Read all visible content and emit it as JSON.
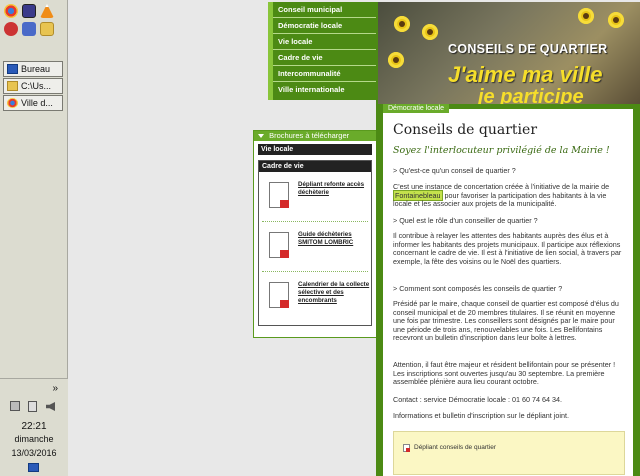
{
  "taskbar": {
    "windows": [
      {
        "label": "Bureau",
        "icon": "desktop-icon"
      },
      {
        "label": "C:\\Us...",
        "icon": "folder-icon"
      },
      {
        "label": "Ville d...",
        "icon": "chrome-icon"
      }
    ],
    "tray": {
      "expand": "»",
      "time": "22:21",
      "day": "dimanche",
      "date": "13/03/2016"
    }
  },
  "menu": {
    "items": [
      "Conseil municipal",
      "Démocratie locale",
      "Vie locale",
      "Cadre de vie",
      "Intercommunalité",
      "Ville internationale"
    ]
  },
  "brochures": {
    "header": "Brochures à télécharger",
    "section_vie_locale": "Vie locale",
    "section_cadre": "Cadre de vie",
    "items": [
      "Dépliant refonte accès déchèterie",
      "Guide déchèteries SMITOM LOMBRIC",
      "Calendrier de la collecte sélective et des encombrants"
    ]
  },
  "banner": {
    "line1": "CONSEILS DE QUARTIER",
    "line2": "J'aime ma ville",
    "line3": "je participe"
  },
  "article": {
    "breadcrumb": "Démocratie locale",
    "title": "Conseils de quartier",
    "subtitle": "Soyez l'interlocuteur privilégié de la Mairie !",
    "q1": "> Qu'est-ce qu'un conseil de quartier ?",
    "a1_before": "C'est une instance de concertation créée à l'initiative de la mairie de ",
    "a1_highlight": "Fontainebleau",
    "a1_after": " pour favoriser la participation des habitants à la vie locale et les associer aux projets de la municipalité.",
    "q2": "> Quel est le rôle d'un conseiller de quartier ?",
    "a2": "Il contribue à relayer les attentes des habitants auprès des élus et à informer les habitants des projets municipaux. Il participe aux réflexions concernant le cadre de vie. Il est à l'initiative de lien social, à travers par exemple, la fête des voisins ou le Noël des quartiers.",
    "q3": "> Comment sont composés les conseils de quartier ?",
    "a3": "Présidé par le maire, chaque conseil de quartier est composé d'élus du conseil municipal et de 20 membres titulaires. Il se réunit en moyenne une fois par trimestre. Les conseillers sont désignés par le maire pour une période de trois ans, renouvelables une fois. Les Bellifontains recevront un bulletin d'inscription dans leur boîte à lettres.",
    "a4": "Attention, il faut être majeur et résident bellifontain pour se présenter ! Les inscriptions sont ouvertes jusqu'au 30 septembre. La première assemblée plénière aura lieu courant octobre.",
    "contact": "Contact : service Démocratie locale : 01 60 74 64 34.",
    "info": "Informations et bulletin d'inscription sur le dépliant joint.",
    "download": "Dépliant conseils de quartier"
  }
}
